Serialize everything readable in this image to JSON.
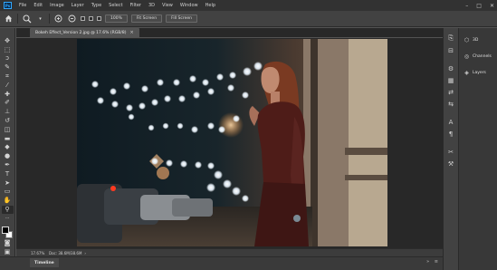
{
  "app": {
    "logo_text": "Ps",
    "menu": [
      "File",
      "Edit",
      "Image",
      "Layer",
      "Type",
      "Select",
      "Filter",
      "3D",
      "View",
      "Window",
      "Help"
    ],
    "window_controls": [
      "–",
      "□",
      "✕"
    ]
  },
  "options_bar": {
    "home_icon": "home-icon",
    "zoom_icon": "zoom-icon",
    "zoom_in_icon": "zoom-in-icon",
    "zoom_out_icon": "zoom-out-icon",
    "zoom_button_label": "100%",
    "fit_screen_label": "Fit Screen",
    "fill_screen_label": "Fill Screen"
  },
  "document": {
    "tab_title": "Bokeh Effect_Version 2.jpg @ 17.6% (RGB/8)",
    "tab_close": "×"
  },
  "status_bar": {
    "zoom": "17.67%",
    "doc_size": "Doc: 38.6M/38.6M",
    "arrow": "›"
  },
  "timeline": {
    "tab_label": "Timeline"
  },
  "panels": {
    "items": [
      {
        "label": "3D",
        "icon": "3d-cube-icon"
      },
      {
        "label": "Channels",
        "icon": "channels-icon"
      },
      {
        "label": "Layers",
        "icon": "layers-icon"
      }
    ]
  },
  "colors": {
    "menubar_bg": "#323232",
    "panel_bg": "#424242",
    "workspace_bg": "#282828",
    "accent": "#31a8ff",
    "foreground_color": "#000000",
    "background_color": "#ffffff"
  }
}
